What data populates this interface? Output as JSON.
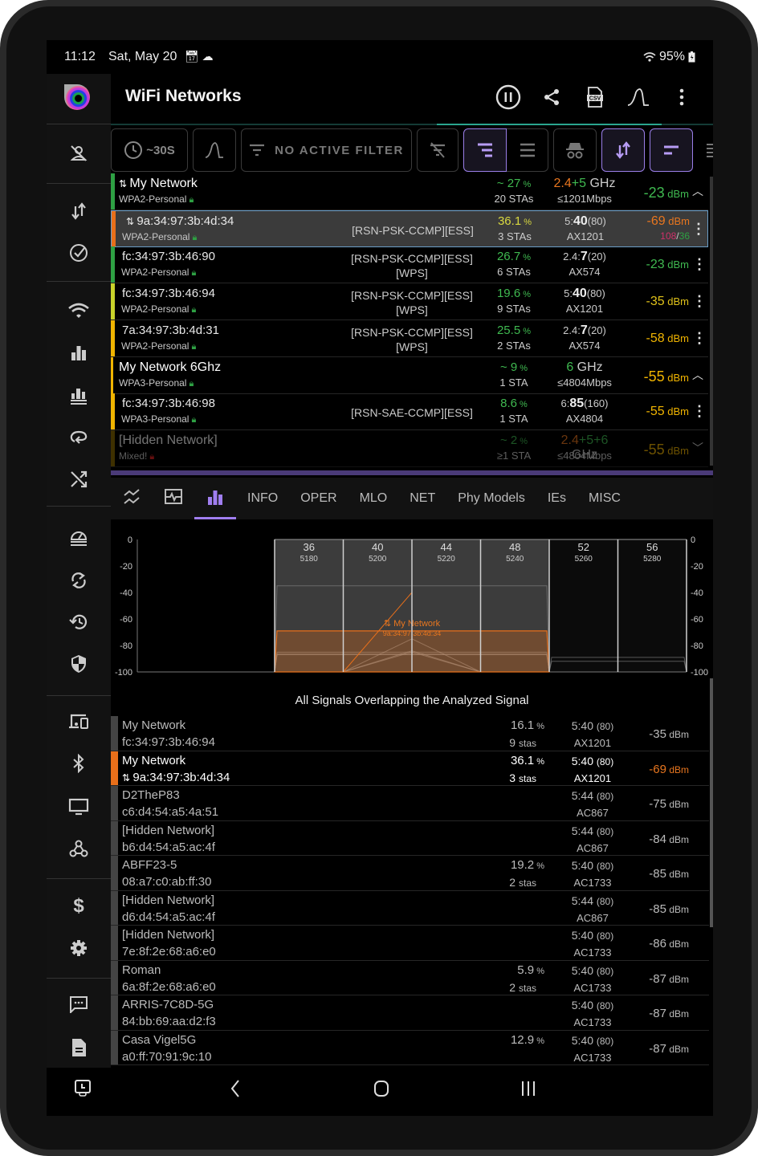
{
  "statusbar": {
    "time": "11:12",
    "date": "Sat, May 20",
    "battery": "95%"
  },
  "appbar": {
    "title": "WiFi Networks",
    "actions": [
      "pause-icon",
      "share-icon",
      "csv-export-icon",
      "signal-curve-icon",
      "more-vert-icon"
    ]
  },
  "sidebar": {
    "items": [
      "no-person-icon",
      "swap-vert-icon",
      "check-circle-icon",
      "wifi-icon",
      "bar-chart-icon",
      "stacked-bar-chart-icon",
      "roaming-icon",
      "shuffle-icon",
      "speedometer-icon",
      "sync-icon",
      "history-icon",
      "security-shield-icon",
      "devices-icon",
      "bluetooth-icon",
      "tv-icon",
      "webhook-icon",
      "dollar-icon",
      "settings-gear-icon",
      "feedback-message-icon",
      "document-icon"
    ]
  },
  "toolbar": {
    "interval": "~30S",
    "filter": "NO ACTIVE FILTER"
  },
  "networks": [
    {
      "type": "group",
      "name": "My Network",
      "connected": true,
      "security": "WPA2-Personal",
      "util": "~ 27",
      "util_color": "#3fb950",
      "stas": "20 STAs",
      "band_a": "2.4",
      "band_b": "+5",
      "band_c": "",
      "band_suffix": " GHz",
      "speed": "≤1201Mbps",
      "signal": "-23",
      "signal_color": "#3fb950",
      "bar_color": "#2ea043",
      "chevron": "^"
    },
    {
      "type": "ap",
      "selected": true,
      "connected": true,
      "name": "9a:34:97:3b:4d:34",
      "security": "WPA2-Personal",
      "caps": "[RSN-PSK-CCMP][ESS]",
      "util": "36.1",
      "util_color": "#d8d840",
      "stas": "3 STAs",
      "chan_band": "5:",
      "chan_num": "40",
      "chan_width": "(80)",
      "phy": "AX1201",
      "signal": "-69",
      "signal_color": "#e8761f",
      "link_tx": "108",
      "link_rx": "36",
      "bar_color": "#e86f1a"
    },
    {
      "type": "ap",
      "name": "fc:34:97:3b:46:90",
      "security": "WPA2-Personal",
      "caps": "[RSN-PSK-CCMP][ESS]",
      "caps2": "[WPS]",
      "util": "26.7",
      "util_color": "#3fb950",
      "stas": "6 STAs",
      "chan_band": "2.4:",
      "chan_num": "7",
      "chan_width": "(20)",
      "phy": "AX574",
      "signal": "-23",
      "signal_color": "#3fb950",
      "bar_color": "#2ea043"
    },
    {
      "type": "ap",
      "name": "fc:34:97:3b:46:94",
      "security": "WPA2-Personal",
      "caps": "[RSN-PSK-CCMP][ESS]",
      "caps2": "[WPS]",
      "util": "19.6",
      "util_color": "#3fb950",
      "stas": "9 STAs",
      "chan_band": "5:",
      "chan_num": "40",
      "chan_width": "(80)",
      "phy": "AX1201",
      "signal": "-35",
      "signal_color": "#e0c21a",
      "bar_color": "#c8d22a"
    },
    {
      "type": "ap",
      "name": "7a:34:97:3b:4d:31",
      "security": "WPA2-Personal",
      "caps": "[RSN-PSK-CCMP][ESS]",
      "caps2": "[WPS]",
      "util": "25.5",
      "util_color": "#3fb950",
      "stas": "2 STAs",
      "chan_band": "2.4:",
      "chan_num": "7",
      "chan_width": "(20)",
      "phy": "AX574",
      "signal": "-58",
      "signal_color": "#f0b400",
      "bar_color": "#f0b400"
    },
    {
      "type": "group",
      "name": "My Network 6Ghz",
      "security": "WPA3-Personal",
      "util": "~ 9",
      "util_color": "#3fb950",
      "stas": "1 STA",
      "band_a": "",
      "band_b": "",
      "band_c": "6",
      "band_suffix": " GHz",
      "speed": "≤4804Mbps",
      "signal": "-55",
      "signal_color": "#f0b400",
      "bar_color": "#f0b400",
      "chevron": "^"
    },
    {
      "type": "ap",
      "name": "fc:34:97:3b:46:98",
      "security": "WPA3-Personal",
      "caps": "[RSN-SAE-CCMP][ESS]",
      "util": "8.6",
      "util_color": "#3fb950",
      "stas": "1 STA",
      "chan_band": "6:",
      "chan_num": "85",
      "chan_width": "(160)",
      "phy": "AX4804",
      "signal": "-55",
      "signal_color": "#f0b400",
      "bar_color": "#f0b400"
    },
    {
      "type": "group",
      "dim": true,
      "name": "[Hidden Network]",
      "security": "Mixed!",
      "util": "~ 2",
      "util_color": "#3fb950",
      "stas": "≥1 STA",
      "band_a": "2.4",
      "band_b": "+5",
      "band_c": "+6",
      "band_suffix": " GHz",
      "speed": "≤4804Mbps",
      "signal": "-55",
      "signal_color": "#f0b400",
      "bar_color": "#8a6a00",
      "chevron": "v"
    }
  ],
  "signal_unit": "dBm",
  "tabs": [
    {
      "icon": "signal-lines-icon"
    },
    {
      "icon": "monitor-heartbeat-icon"
    },
    {
      "icon": "bar-chart-icon",
      "active": true
    },
    {
      "label": "INFO"
    },
    {
      "label": "OPER"
    },
    {
      "label": "MLO"
    },
    {
      "label": "NET"
    },
    {
      "label": "Phy Models"
    },
    {
      "label": "IEs"
    },
    {
      "label": "MISC"
    }
  ],
  "chart_data": {
    "type": "area",
    "title": "",
    "ylim": [
      -100,
      0
    ],
    "yticks": [
      "0",
      "-20",
      "-40",
      "-60",
      "-80",
      "-100"
    ],
    "channels": [
      {
        "ch": "36",
        "freq": "5180",
        "in_band": true
      },
      {
        "ch": "40",
        "freq": "5200",
        "in_band": true
      },
      {
        "ch": "44",
        "freq": "5220",
        "in_band": true
      },
      {
        "ch": "48",
        "freq": "5240",
        "in_band": true
      },
      {
        "ch": "52",
        "freq": "5260",
        "in_band": false
      },
      {
        "ch": "56",
        "freq": "5280",
        "in_band": false
      }
    ],
    "highlight": {
      "label": "My Network",
      "bssid": "9a:34:97:3b:4d:34",
      "signal": -69,
      "channels": [
        "36",
        "48"
      ]
    },
    "others": [
      {
        "signal": -35,
        "channels": [
          "36",
          "48"
        ]
      },
      {
        "signal": -85,
        "channels": [
          "36",
          "48"
        ]
      },
      {
        "signal": -86,
        "channels": [
          "36",
          "48"
        ]
      },
      {
        "signal": -87,
        "channels": [
          "36",
          "48"
        ]
      },
      {
        "signal": -87,
        "channels": [
          "36",
          "48"
        ]
      },
      {
        "signal": -87,
        "channels": [
          "36",
          "48"
        ]
      },
      {
        "signal": -75,
        "peak": "44"
      },
      {
        "signal": -84,
        "peak": "44"
      },
      {
        "signal": -85,
        "peak": "44"
      },
      {
        "signal": -89,
        "channels": [
          "52",
          "56"
        ]
      },
      {
        "signal": -92,
        "channels": [
          "52",
          "56"
        ]
      }
    ]
  },
  "overlap": {
    "title": "All Signals Overlapping the Analyzed Signal",
    "rows": [
      {
        "name": "My Network",
        "bssid": "fc:34:97:3b:46:94",
        "util": "16.1",
        "stas": "9",
        "chan": "5:40",
        "width": "(80)",
        "phy": "AX1201",
        "signal": "-35"
      },
      {
        "name": "My Network",
        "bssid": "9a:34:97:3b:4d:34",
        "connected": true,
        "highlight": true,
        "util": "36.1",
        "stas": "3",
        "chan": "5:40",
        "width": "(80)",
        "phy": "AX1201",
        "signal": "-69"
      },
      {
        "name": "D2TheP83",
        "bssid": "c6:d4:54:a5:4a:51",
        "util": "",
        "stas": "",
        "chan": "5:44",
        "width": "(80)",
        "phy": "AC867",
        "signal": "-75"
      },
      {
        "name": "[Hidden Network]",
        "bssid": "b6:d4:54:a5:ac:4f",
        "util": "",
        "stas": "",
        "chan": "5:44",
        "width": "(80)",
        "phy": "AC867",
        "signal": "-84"
      },
      {
        "name": "ABFF23-5",
        "bssid": "08:a7:c0:ab:ff:30",
        "util": "19.2",
        "stas": "2",
        "chan": "5:40",
        "width": "(80)",
        "phy": "AC1733",
        "signal": "-85"
      },
      {
        "name": "[Hidden Network]",
        "bssid": "d6:d4:54:a5:ac:4f",
        "util": "",
        "stas": "",
        "chan": "5:44",
        "width": "(80)",
        "phy": "AC867",
        "signal": "-85"
      },
      {
        "name": "[Hidden Network]",
        "bssid": "7e:8f:2e:68:a6:e0",
        "util": "",
        "stas": "",
        "chan": "5:40",
        "width": "(80)",
        "phy": "AC1733",
        "signal": "-86"
      },
      {
        "name": "Roman",
        "bssid": "6a:8f:2e:68:a6:e0",
        "util": "5.9",
        "stas": "2",
        "chan": "5:40",
        "width": "(80)",
        "phy": "AC1733",
        "signal": "-87"
      },
      {
        "name": "ARRIS-7C8D-5G",
        "bssid": "84:bb:69:aa:d2:f3",
        "util": "",
        "stas": "",
        "chan": "5:40",
        "width": "(80)",
        "phy": "AC1733",
        "signal": "-87"
      },
      {
        "name": "Casa Vigel5G",
        "bssid": "a0:ff:70:91:9c:10",
        "util": "12.9",
        "stas": "",
        "chan": "5:40",
        "width": "(80)",
        "phy": "AC1733",
        "signal": "-87"
      }
    ],
    "stas_unit": "stas"
  },
  "colors": {
    "accent": "#a07ef0",
    "connected": "#e86f1a",
    "good": "#3fb950",
    "fair": "#f0b400",
    "bad": "#e8761f"
  }
}
